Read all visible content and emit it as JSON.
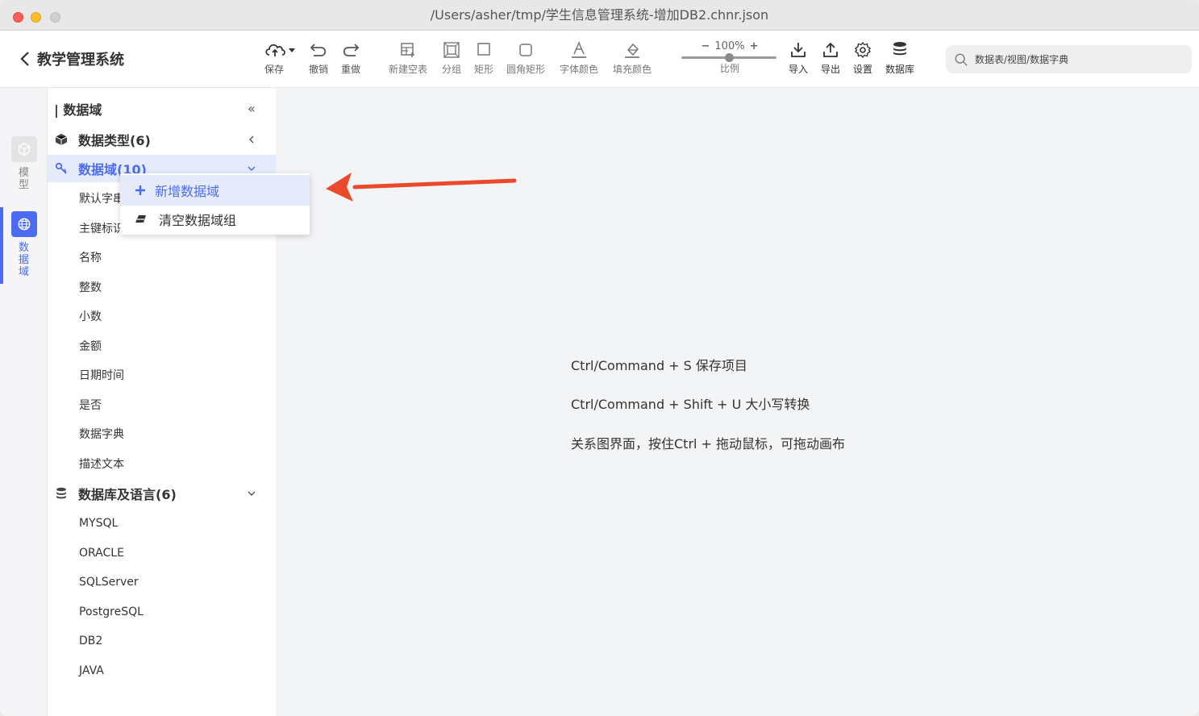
{
  "window": {
    "title": "/Users/asher/tmp/学生信息管理系统-增加DB2.chnr.json"
  },
  "app": {
    "name": "教学管理系统"
  },
  "toolbar": {
    "save": "保存",
    "undo": "撤销",
    "redo": "重做",
    "new_table": "新建空表",
    "group": "分组",
    "rect": "矩形",
    "round_rect": "圆角矩形",
    "font_color": "字体颜色",
    "fill_color": "填充颜色",
    "zoom_value": "100%",
    "zoom_label": "比例",
    "zoom_fraction": 0.5,
    "import": "导入",
    "export": "导出",
    "settings": "设置",
    "database": "数据库"
  },
  "search": {
    "placeholder": "数据表/视图/数据字典"
  },
  "rail": {
    "model": "模型",
    "domain": "数据域"
  },
  "sidebar": {
    "title": "数据域",
    "collapse": "«",
    "groups": [
      {
        "label": "数据类型(6)"
      },
      {
        "label": "数据域(10)"
      },
      {
        "label": "数据库及语言(6)"
      }
    ],
    "domain_items": [
      "默认字串",
      "主键标识",
      "名称",
      "整数",
      "小数",
      "金额",
      "日期时间",
      "是否",
      "数据字典",
      "描述文本"
    ],
    "db_items": [
      "MYSQL",
      "ORACLE",
      "SQLServer",
      "PostgreSQL",
      "DB2",
      "JAVA"
    ]
  },
  "context_menu": {
    "add": "新增数据域",
    "clear": "清空数据域组"
  },
  "tips": [
    "Ctrl/Command + S 保存项目",
    "Ctrl/Command + Shift + U 大小写转换",
    "关系图界面，按住Ctrl + 拖动鼠标，可拖动画布"
  ],
  "colors": {
    "accent": "#4b6cf2",
    "arrow": "#ea4a2b"
  }
}
